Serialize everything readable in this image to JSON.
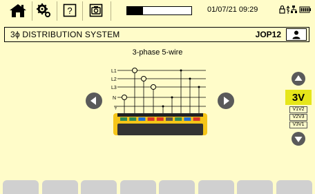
{
  "status_bar": {
    "datetime": "01/07/21 09:29",
    "progress_fraction": 0.25,
    "icons": [
      "home-icon",
      "settings-icon",
      "help-icon",
      "camera-icon",
      "lock-icon",
      "usb-icon",
      "network-icon",
      "battery-icon"
    ],
    "help_glyph": "?"
  },
  "title_bar": {
    "title": "3ϕ  DISTRIBUTION SYSTEM",
    "profile": "JOP12"
  },
  "diagram": {
    "title": "3-phase 5-wire",
    "lines": [
      "L1",
      "L2",
      "L3",
      "N"
    ],
    "terminal_colors": [
      "#2e8b57",
      "#2e8b57",
      "#1f6fd6",
      "#d9342b",
      "#d9342b",
      "#555555",
      "#2e8b57",
      "#1f6fd6",
      "#d9342b"
    ]
  },
  "mode_selector": {
    "selected": "3V",
    "options": [
      "V1V2",
      "V2V3",
      "V3V1"
    ]
  },
  "colors": {
    "background": "#fffcc9",
    "accent": "#e6e61a",
    "instrument": "#f5c518",
    "arrow": "#5a5a5a",
    "fkey": "#d0d0d0"
  },
  "function_keys_count": 8
}
